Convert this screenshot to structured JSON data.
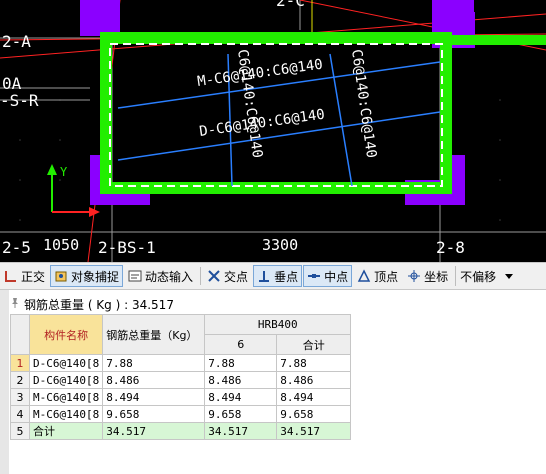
{
  "cad": {
    "grid_labels": {
      "row_2a": "2-A",
      "row_0a": "0A",
      "row_s_r": "-S-R",
      "row_2c": "2-C",
      "col_2_5": "2-5",
      "col_2_bs1": "2-BS-1",
      "col_2_8": "2-8"
    },
    "dimensions": [
      "1050",
      "3300"
    ],
    "rebar_labels": {
      "top_horizontal": "M-C6@140:C6@140",
      "bottom_horizontal": "D-C6@140:C6@140",
      "left_vertical": "C6@140:C6@140",
      "right_vertical": "C6@140:C6@140"
    },
    "axis_label": "Y",
    "colors": {
      "background": "#000000",
      "wall_outline": "#22ee00",
      "column": "#8b00ff",
      "rebar": "#2a7fff",
      "grid_line": "#ff2222",
      "text": "#ffffff"
    }
  },
  "toolbar": {
    "items": [
      {
        "icon": "ortho-icon",
        "label": "正交",
        "active": false
      },
      {
        "icon": "object-snap-icon",
        "label": "对象捕捉",
        "active": true
      },
      {
        "icon": "dynamic-input-icon",
        "label": "动态输入",
        "active": false
      },
      {
        "icon": "intersection-icon",
        "label": "交点",
        "active": false
      },
      {
        "icon": "perpendicular-icon",
        "label": "垂点",
        "active": true
      },
      {
        "icon": "midpoint-icon",
        "label": "中点",
        "active": true
      },
      {
        "icon": "vertex-icon",
        "label": "顶点",
        "active": false
      },
      {
        "icon": "coordinate-icon",
        "label": "坐标",
        "active": false
      }
    ],
    "offset_select": {
      "value": "不偏移"
    }
  },
  "summary": {
    "label": "钢筋总重量 ( Kg ) : 34.517"
  },
  "table": {
    "headers": {
      "name": "构件名称",
      "total_weight": "钢筋总重量（Kg）",
      "group": "HRB400",
      "sub_6": "6",
      "sub_total": "合计"
    },
    "rows": [
      {
        "index": "1",
        "name": "D-C6@140[8",
        "total": "7.88",
        "d6": "7.88",
        "sum": "7.88"
      },
      {
        "index": "2",
        "name": "D-C6@140[8",
        "total": "8.486",
        "d6": "8.486",
        "sum": "8.486"
      },
      {
        "index": "3",
        "name": "M-C6@140[8",
        "total": "8.494",
        "d6": "8.494",
        "sum": "8.494"
      },
      {
        "index": "4",
        "name": "M-C6@140[8",
        "total": "9.658",
        "d6": "9.658",
        "sum": "9.658"
      },
      {
        "index": "5",
        "name": "合计",
        "total": "34.517",
        "d6": "34.517",
        "sum": "34.517"
      }
    ]
  }
}
